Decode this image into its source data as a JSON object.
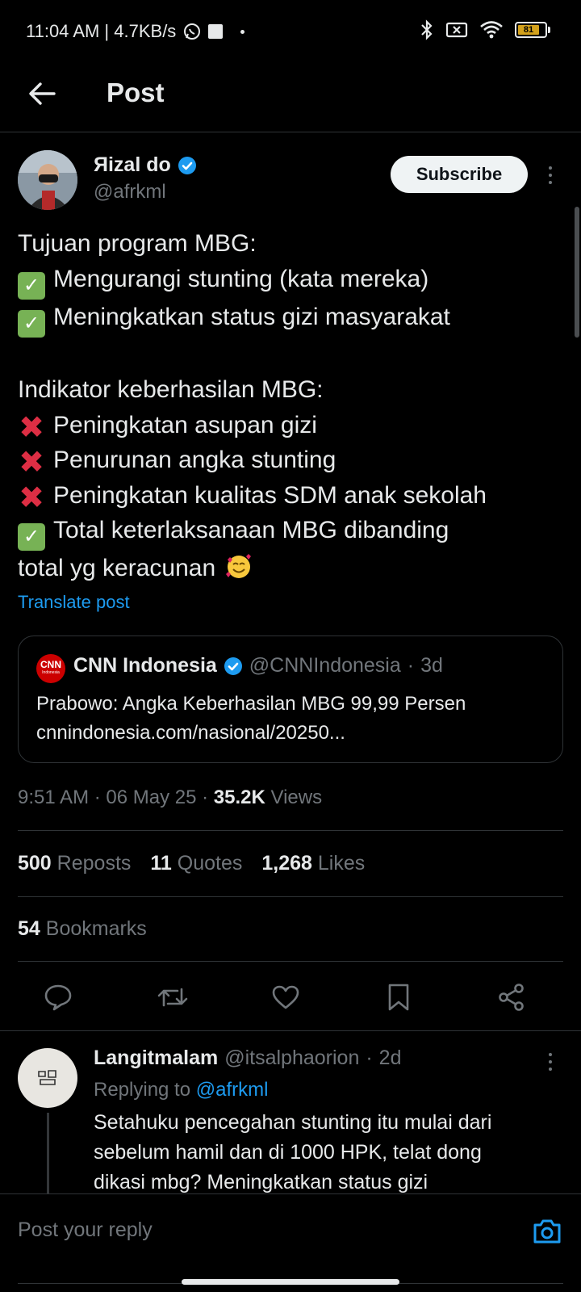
{
  "status_bar": {
    "time_speed": "11:04 AM | 4.7KB/s",
    "battery_level": "81"
  },
  "header": {
    "title": "Post"
  },
  "author": {
    "name": "Яizal do",
    "handle": "@afrkml",
    "subscribe_label": "Subscribe",
    "verified_color": "#1d9bf0"
  },
  "post": {
    "lines": [
      {
        "emoji": "",
        "text": "Tujuan program MBG:"
      },
      {
        "emoji": "check-mark",
        "text": "Mengurangi stunting (kata mereka)"
      },
      {
        "emoji": "check-mark",
        "text": "Meningkatkan status gizi masyarakat"
      },
      {
        "emoji": "",
        "text": ""
      },
      {
        "emoji": "",
        "text": "Indikator keberhasilan MBG:"
      },
      {
        "emoji": "cross-mark",
        "text": "Peningkatan asupan gizi"
      },
      {
        "emoji": "cross-mark",
        "text": "Penurunan angka stunting"
      },
      {
        "emoji": "cross-mark",
        "text": "Peningkatan kualitas SDM anak sekolah"
      },
      {
        "emoji": "check-mark",
        "text": "Total keterlaksanaan MBG dibanding"
      },
      {
        "emoji": "",
        "text": "total yg keracunan",
        "trailing_emoji": "smiling-face-with-hearts"
      }
    ],
    "translate_label": "Translate post"
  },
  "quote": {
    "logo_text": "CNN",
    "logo_subtext": "Indonesia",
    "name": "CNN Indonesia",
    "handle": "@CNNIndonesia",
    "separator": "·",
    "time": "3d",
    "line1": "Prabowo: Angka Keberhasilan MBG 99,99 Persen",
    "line2": "cnnindonesia.com/nasional/20250..."
  },
  "meta": {
    "time": "9:51 AM",
    "date": "06 May 25",
    "views_count": "35.2K",
    "views_label": "Views"
  },
  "stats": {
    "reposts_count": "500",
    "reposts_label": "Reposts",
    "quotes_count": "11",
    "quotes_label": "Quotes",
    "likes_count": "1,268",
    "likes_label": "Likes",
    "bookmarks_count": "54",
    "bookmarks_label": "Bookmarks"
  },
  "actions": [
    "reply-icon",
    "repost-icon",
    "like-icon",
    "bookmark-icon",
    "share-icon"
  ],
  "reply": {
    "name": "Langitmalam",
    "handle": "@itsalphaorion",
    "separator": "·",
    "time": "2d",
    "replying_prefix": "Replying to",
    "replying_handle": "@afrkml",
    "text_lines": [
      "Setahuku pencegahan stunting itu mulai dari",
      "sebelum hamil dan di 1000 HPK, telat dong",
      "dikasi mbg? Meningkatkan status gizi"
    ]
  },
  "composer": {
    "placeholder": "Post your reply"
  },
  "colors": {
    "background": "#000000",
    "accent": "#1d9bf0",
    "check": "#77b255",
    "cross": "#dd2e44",
    "muted": "#71767b"
  }
}
